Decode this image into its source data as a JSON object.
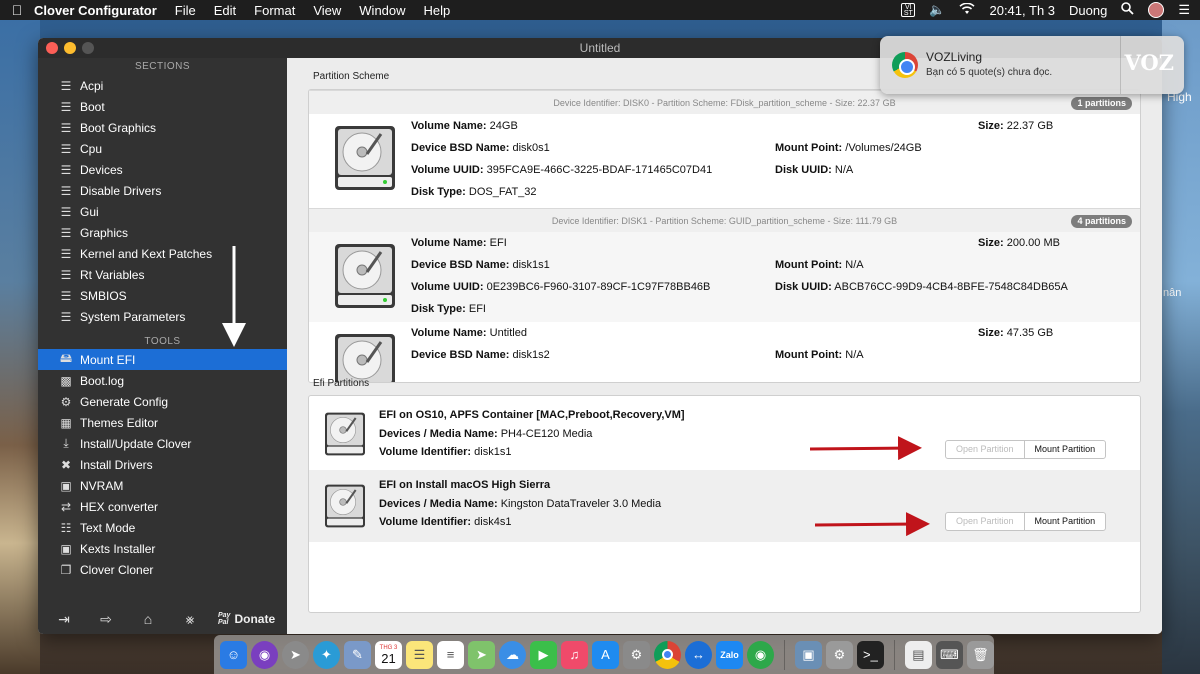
{
  "menubar": {
    "app_name": "Clover Configurator",
    "items": [
      "File",
      "Edit",
      "Format",
      "View",
      "Window",
      "Help"
    ],
    "datetime": "20:41, Th 3",
    "user": "Duong"
  },
  "notification": {
    "title": "VOZLiving",
    "body": "Bạn có 5 quote(s) chưa đọc.",
    "brand": "VOZ"
  },
  "window": {
    "title": "Untitled"
  },
  "sidebar": {
    "sections_heading": "SECTIONS",
    "sections": [
      "Acpi",
      "Boot",
      "Boot Graphics",
      "Cpu",
      "Devices",
      "Disable Drivers",
      "Gui",
      "Graphics",
      "Kernel and Kext Patches",
      "Rt Variables",
      "SMBIOS",
      "System Parameters"
    ],
    "tools_heading": "TOOLS",
    "tools": [
      "Mount EFI",
      "Boot.log",
      "Generate Config",
      "Themes Editor",
      "Install/Update Clover",
      "Install Drivers",
      "NVRAM",
      "HEX converter",
      "Text Mode",
      "Kexts Installer",
      "Clover Cloner"
    ],
    "selected_tool": "Mount EFI",
    "donate_label": "Donate",
    "paypal_line1": "Pay",
    "paypal_line2": "Pal"
  },
  "partition_scheme": {
    "label": "Partition Scheme",
    "disks": [
      {
        "header": "Device Identifier: DISK0 - Partition Scheme: FDisk_partition_scheme - Size: 22.37 GB",
        "badge": "1 partitions",
        "volumes": [
          {
            "volume_name_label": "Volume Name:",
            "volume_name": "24GB",
            "size_label": "Size:",
            "size": "22.37 GB",
            "bsd_label": "Device BSD Name:",
            "bsd": "disk0s1",
            "mount_label": "Mount Point:",
            "mount": "/Volumes/24GB",
            "uuid_label": "Volume UUID:",
            "uuid": "395FCA9E-466C-3225-BDAF-171465C07D41",
            "disk_uuid_label": "Disk UUID:",
            "disk_uuid": "N/A",
            "type_label": "Disk Type:",
            "type": "DOS_FAT_32"
          }
        ]
      },
      {
        "header": "Device Identifier: DISK1 - Partition Scheme: GUID_partition_scheme - Size: 111.79 GB",
        "badge": "4 partitions",
        "volumes": [
          {
            "volume_name_label": "Volume Name:",
            "volume_name": "EFI",
            "size_label": "Size:",
            "size": "200.00 MB",
            "bsd_label": "Device BSD Name:",
            "bsd": "disk1s1",
            "mount_label": "Mount Point:",
            "mount": "N/A",
            "uuid_label": "Volume UUID:",
            "uuid": "0E239BC6-F960-3107-89CF-1C97F78BB46B",
            "disk_uuid_label": "Disk UUID:",
            "disk_uuid": "ABCB76CC-99D9-4CB4-8BFE-7548C84DB65A",
            "type_label": "Disk Type:",
            "type": "EFI"
          },
          {
            "volume_name_label": "Volume Name:",
            "volume_name": "Untitled",
            "size_label": "Size:",
            "size": "47.35 GB",
            "bsd_label": "Device BSD Name:",
            "bsd": "disk1s2",
            "mount_label": "Mount Point:",
            "mount": "N/A"
          }
        ]
      }
    ]
  },
  "efi_partitions": {
    "label": "Efi Partitions",
    "items": [
      {
        "title": "EFI on OS10, APFS Container [MAC,Preboot,Recovery,VM]",
        "media_label": "Devices / Media Name:",
        "media": "PH4-CE120 Media",
        "vid_label": "Volume Identifier:",
        "vid": "disk1s1",
        "open_label": "Open Partition",
        "mount_label": "Mount Partition"
      },
      {
        "title": "EFI on Install macOS High Sierra",
        "media_label": "Devices / Media Name:",
        "media": "Kingston DataTraveler 3.0 Media",
        "vid_label": "Volume Identifier:",
        "vid": "disk4s1",
        "open_label": "Open Partition",
        "mount_label": "Mount Partition"
      }
    ]
  },
  "desktop_text": {
    "right_fragment_1": "High",
    "right_fragment_2": "nân"
  },
  "dock": {
    "calendar_month": "THG 3",
    "calendar_day": "21",
    "icons": [
      "finder-icon",
      "siri-icon",
      "launchpad-icon",
      "safari-icon",
      "preview-icon",
      "calendar-icon",
      "notes-icon",
      "reminders-icon",
      "maps-icon",
      "messages-icon",
      "facetime-icon",
      "music-icon",
      "appstore-icon",
      "preferences-icon",
      "chrome-icon",
      "teamviewer-icon",
      "zalo-icon",
      "network-icon",
      "photos-icon",
      "utility-icon",
      "terminal-icon",
      "document-icon",
      "keyboard-icon",
      "trash-icon"
    ],
    "zalo_label": "Zalo"
  },
  "colors": {
    "selection": "#1c6ed6",
    "sidebar_bg": "#323232",
    "arrow_red": "#c0141b",
    "arrow_white": "#ffffff"
  }
}
